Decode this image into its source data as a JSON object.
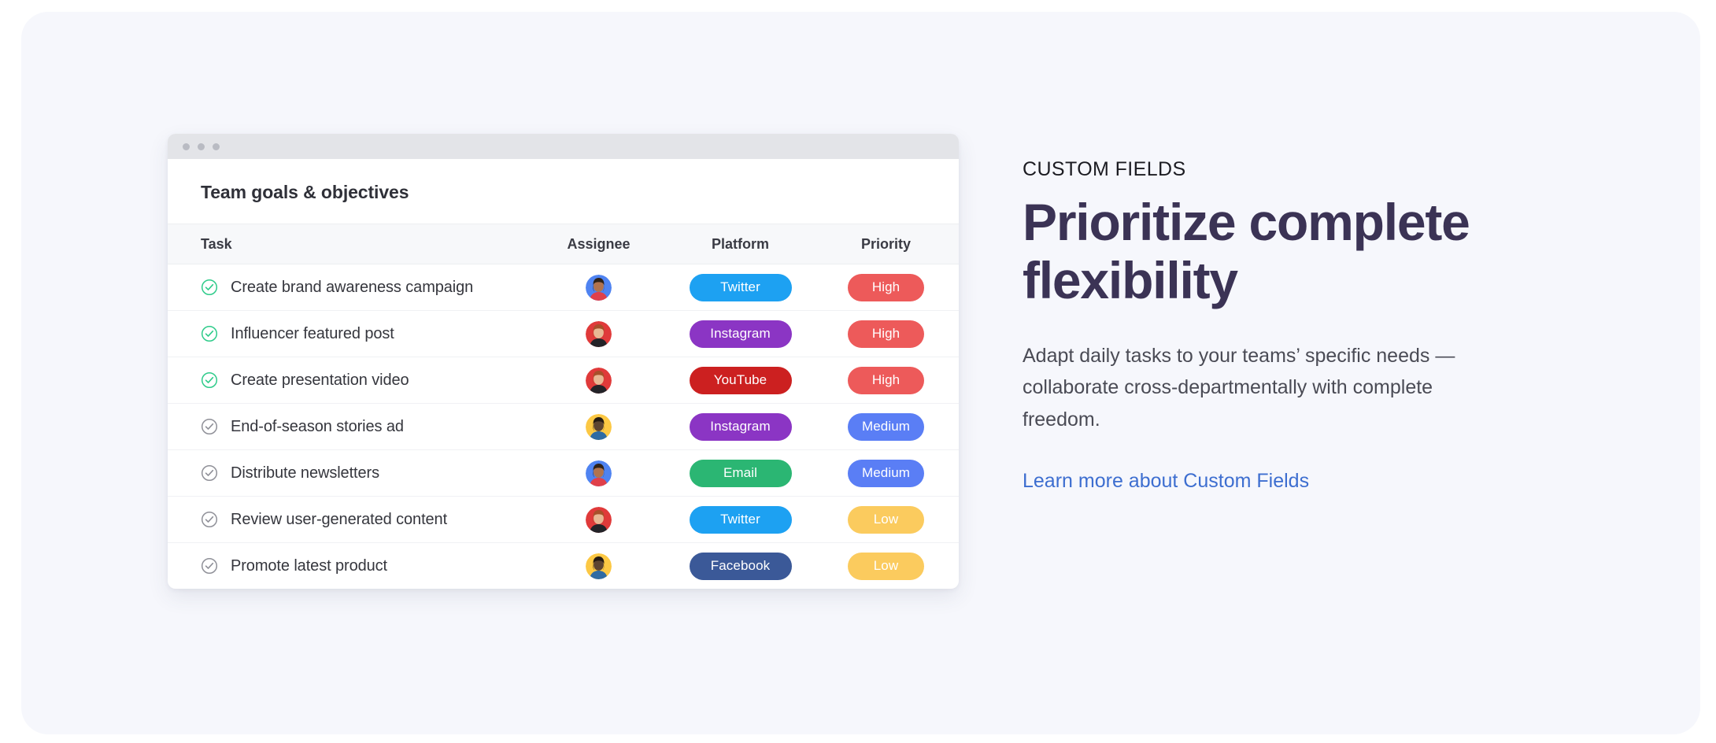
{
  "panel": {
    "background_color": "#f6f7fc"
  },
  "app_card": {
    "titlebar": {
      "dot_count": 3,
      "dot_color": "#b9bbc3",
      "background_color": "#e3e4e8"
    },
    "title": "Team goals & objectives",
    "table": {
      "columns": [
        "Task",
        "Assignee",
        "Platform",
        "Priority"
      ],
      "rows": [
        {
          "task": "Create brand awareness campaign",
          "checked": true,
          "check_color": "#2ecb8a",
          "assignee": {
            "name": "avatar-woman-blue",
            "bg": "#4f83f1",
            "skin": "#b2734d",
            "hair": "#2f2218",
            "shirt": "#e0404a"
          },
          "platform": {
            "label": "Twitter",
            "color": "#1da1f2"
          },
          "priority": {
            "label": "High",
            "color": "#ed5a5a"
          }
        },
        {
          "task": "Influencer featured post",
          "checked": true,
          "check_color": "#2ecb8a",
          "assignee": {
            "name": "avatar-woman-red",
            "bg": "#e03a3a",
            "skin": "#e8b894",
            "hair": "#a8502a",
            "shirt": "#232328"
          },
          "platform": {
            "label": "Instagram",
            "color": "#8b35c4"
          },
          "priority": {
            "label": "High",
            "color": "#ed5a5a"
          }
        },
        {
          "task": "Create presentation video",
          "checked": true,
          "check_color": "#2ecb8a",
          "assignee": {
            "name": "avatar-woman-red",
            "bg": "#e03a3a",
            "skin": "#e8b894",
            "hair": "#a8502a",
            "shirt": "#232328"
          },
          "platform": {
            "label": "YouTube",
            "color": "#cc2020"
          },
          "priority": {
            "label": "High",
            "color": "#ed5a5a"
          }
        },
        {
          "task": "End-of-season stories ad",
          "checked": false,
          "check_color": "#8f9098",
          "assignee": {
            "name": "avatar-man-yellow",
            "bg": "#fcc844",
            "skin": "#5d4431",
            "hair": "#241a12",
            "shirt": "#2f6ba3"
          },
          "platform": {
            "label": "Instagram",
            "color": "#8b35c4"
          },
          "priority": {
            "label": "Medium",
            "color": "#5a7ef5"
          }
        },
        {
          "task": "Distribute newsletters",
          "checked": false,
          "check_color": "#8f9098",
          "assignee": {
            "name": "avatar-woman-blue",
            "bg": "#4f83f1",
            "skin": "#b2734d",
            "hair": "#2f2218",
            "shirt": "#e0404a"
          },
          "platform": {
            "label": "Email",
            "color": "#2bb673"
          },
          "priority": {
            "label": "Medium",
            "color": "#5a7ef5"
          }
        },
        {
          "task": "Review user-generated content",
          "checked": false,
          "check_color": "#8f9098",
          "assignee": {
            "name": "avatar-woman-red",
            "bg": "#e03a3a",
            "skin": "#e8b894",
            "hair": "#a8502a",
            "shirt": "#232328"
          },
          "platform": {
            "label": "Twitter",
            "color": "#1da1f2"
          },
          "priority": {
            "label": "Low",
            "color": "#fbcb5e"
          }
        },
        {
          "task": "Promote latest product",
          "checked": false,
          "check_color": "#8f9098",
          "assignee": {
            "name": "avatar-man-yellow",
            "bg": "#fcc844",
            "skin": "#5d4431",
            "hair": "#241a12",
            "shirt": "#2f6ba3"
          },
          "platform": {
            "label": "Facebook",
            "color": "#3b5998"
          },
          "priority": {
            "label": "Low",
            "color": "#fbcb5e"
          }
        }
      ]
    }
  },
  "content": {
    "eyebrow": "CUSTOM FIELDS",
    "headline": "Prioritize complete flexibility",
    "body": "Adapt daily tasks to your teams’ specific needs — collaborate cross-departmentally with complete freedom.",
    "link_label": "Learn more about Custom Fields",
    "link_color": "#3d6ed0",
    "headline_color": "#3b3355"
  }
}
